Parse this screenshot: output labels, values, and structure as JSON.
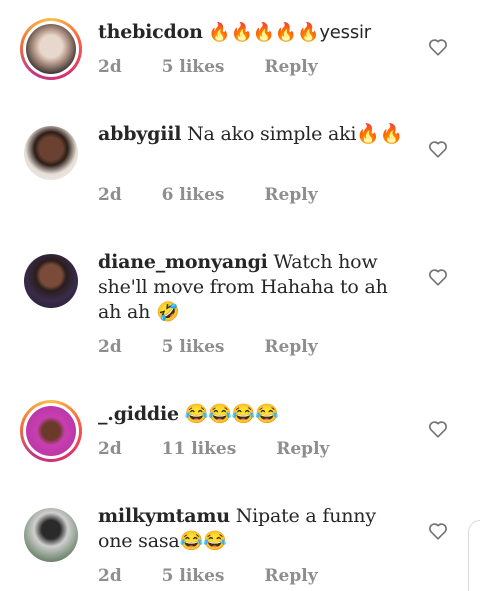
{
  "comments": [
    {
      "username": "thebicdon",
      "text": " 🔥🔥🔥🔥🔥yessir",
      "age": "2d",
      "likes": "5 likes",
      "reply": "Reply"
    },
    {
      "username": "abbygiil",
      "text": " Na ako simple aki🔥🔥",
      "age": "2d",
      "likes": "6 likes",
      "reply": "Reply"
    },
    {
      "username": "diane_monyangi",
      "text": " Watch how she'll move from Hahaha to ah ah ah 🤣",
      "age": "2d",
      "likes": "5 likes",
      "reply": "Reply"
    },
    {
      "username": "_.giddie",
      "text": " 😂😂😂😂",
      "age": "2d",
      "likes": "11 likes",
      "reply": "Reply"
    },
    {
      "username": "milkymtamu",
      "text": " Nipate a funny one sasa😂😂",
      "age": "2d",
      "likes": "5 likes",
      "reply": "Reply"
    }
  ],
  "icons": {
    "like": "heart-outline-icon"
  }
}
